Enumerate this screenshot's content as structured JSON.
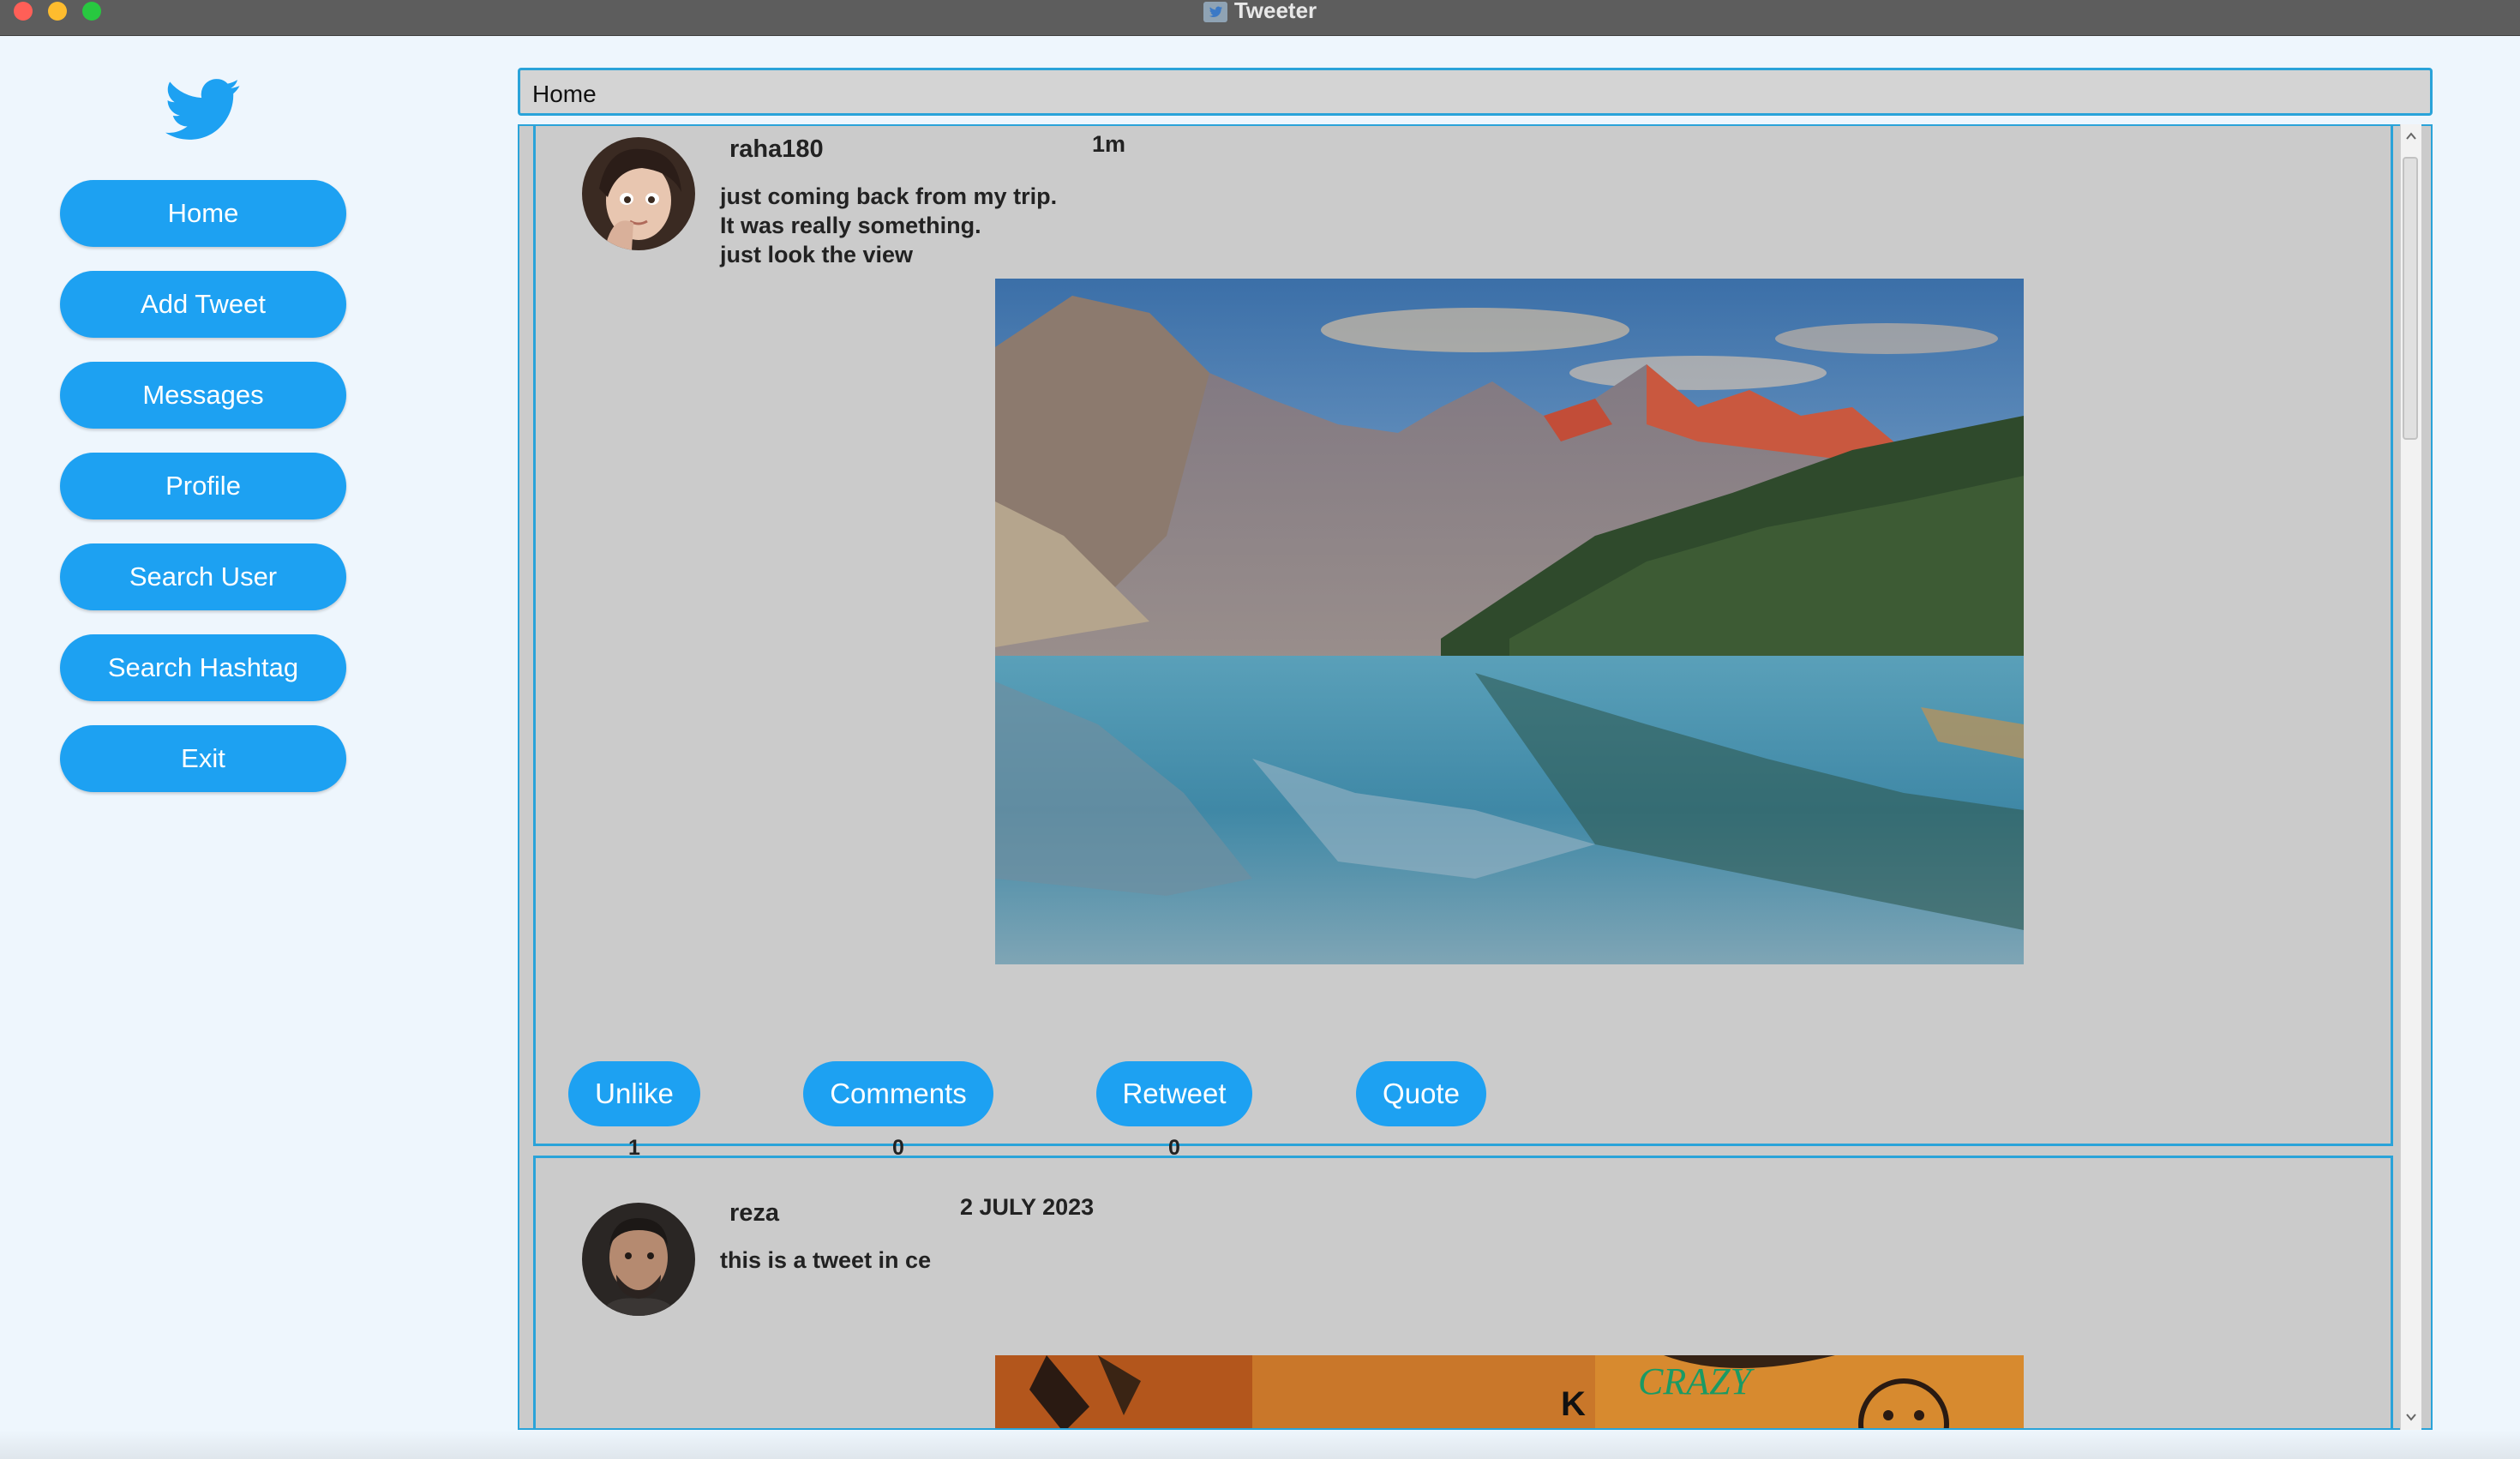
{
  "window": {
    "title": "Tweeter"
  },
  "sidebar": {
    "items": [
      {
        "label": "Home"
      },
      {
        "label": "Add Tweet"
      },
      {
        "label": "Messages"
      },
      {
        "label": "Profile"
      },
      {
        "label": "Search User"
      },
      {
        "label": "Search Hashtag"
      },
      {
        "label": "Exit"
      }
    ]
  },
  "header": {
    "title": "Home"
  },
  "tweets": [
    {
      "username": "raha180",
      "time": "1m",
      "lines": [
        "just coming back from my trip.",
        "It was really something.",
        "just look the view"
      ],
      "actions": [
        {
          "label": "Unlike",
          "count": "1"
        },
        {
          "label": "Comments",
          "count": "0"
        },
        {
          "label": "Retweet",
          "count": "0"
        },
        {
          "label": "Quote"
        }
      ]
    },
    {
      "username": "reza",
      "time": "2 JULY 2023",
      "lines": [
        "this is a tweet in ce"
      ],
      "image_text": [
        "K",
        "CRAZY"
      ]
    }
  ],
  "colors": {
    "accent": "#1da1f2",
    "border": "#2aa3d9",
    "panel": "#cbcbcb",
    "background": "#eef6fd"
  },
  "icons": [
    "twitter-bird-icon",
    "scroll-up-arrow-icon",
    "scroll-down-arrow-icon"
  ]
}
